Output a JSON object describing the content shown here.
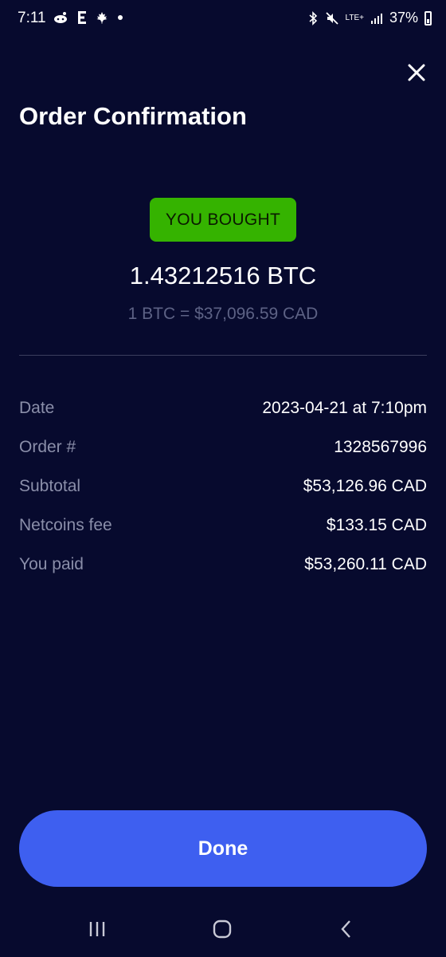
{
  "status_bar": {
    "time": "7:11",
    "left_icons": [
      "reddit-icon",
      "e-icon",
      "maple-leaf-icon",
      "dot-icon"
    ],
    "network": "LTE+",
    "battery": "37%"
  },
  "header": {
    "title": "Order Confirmation"
  },
  "order": {
    "badge": "YOU BOUGHT",
    "amount": "1.43212516 BTC",
    "rate": "1 BTC = $37,096.59 CAD",
    "badge_color": "#35b300"
  },
  "details": [
    {
      "label": "Date",
      "value": "2023-04-21 at 7:10pm"
    },
    {
      "label": "Order #",
      "value": "1328567996"
    },
    {
      "label": "Subtotal",
      "value": "$53,126.96 CAD"
    },
    {
      "label": "Netcoins fee",
      "value": "$133.15 CAD"
    },
    {
      "label": "You paid",
      "value": "$53,260.11 CAD"
    }
  ],
  "actions": {
    "done_label": "Done",
    "accent": "#3e5ff0"
  }
}
